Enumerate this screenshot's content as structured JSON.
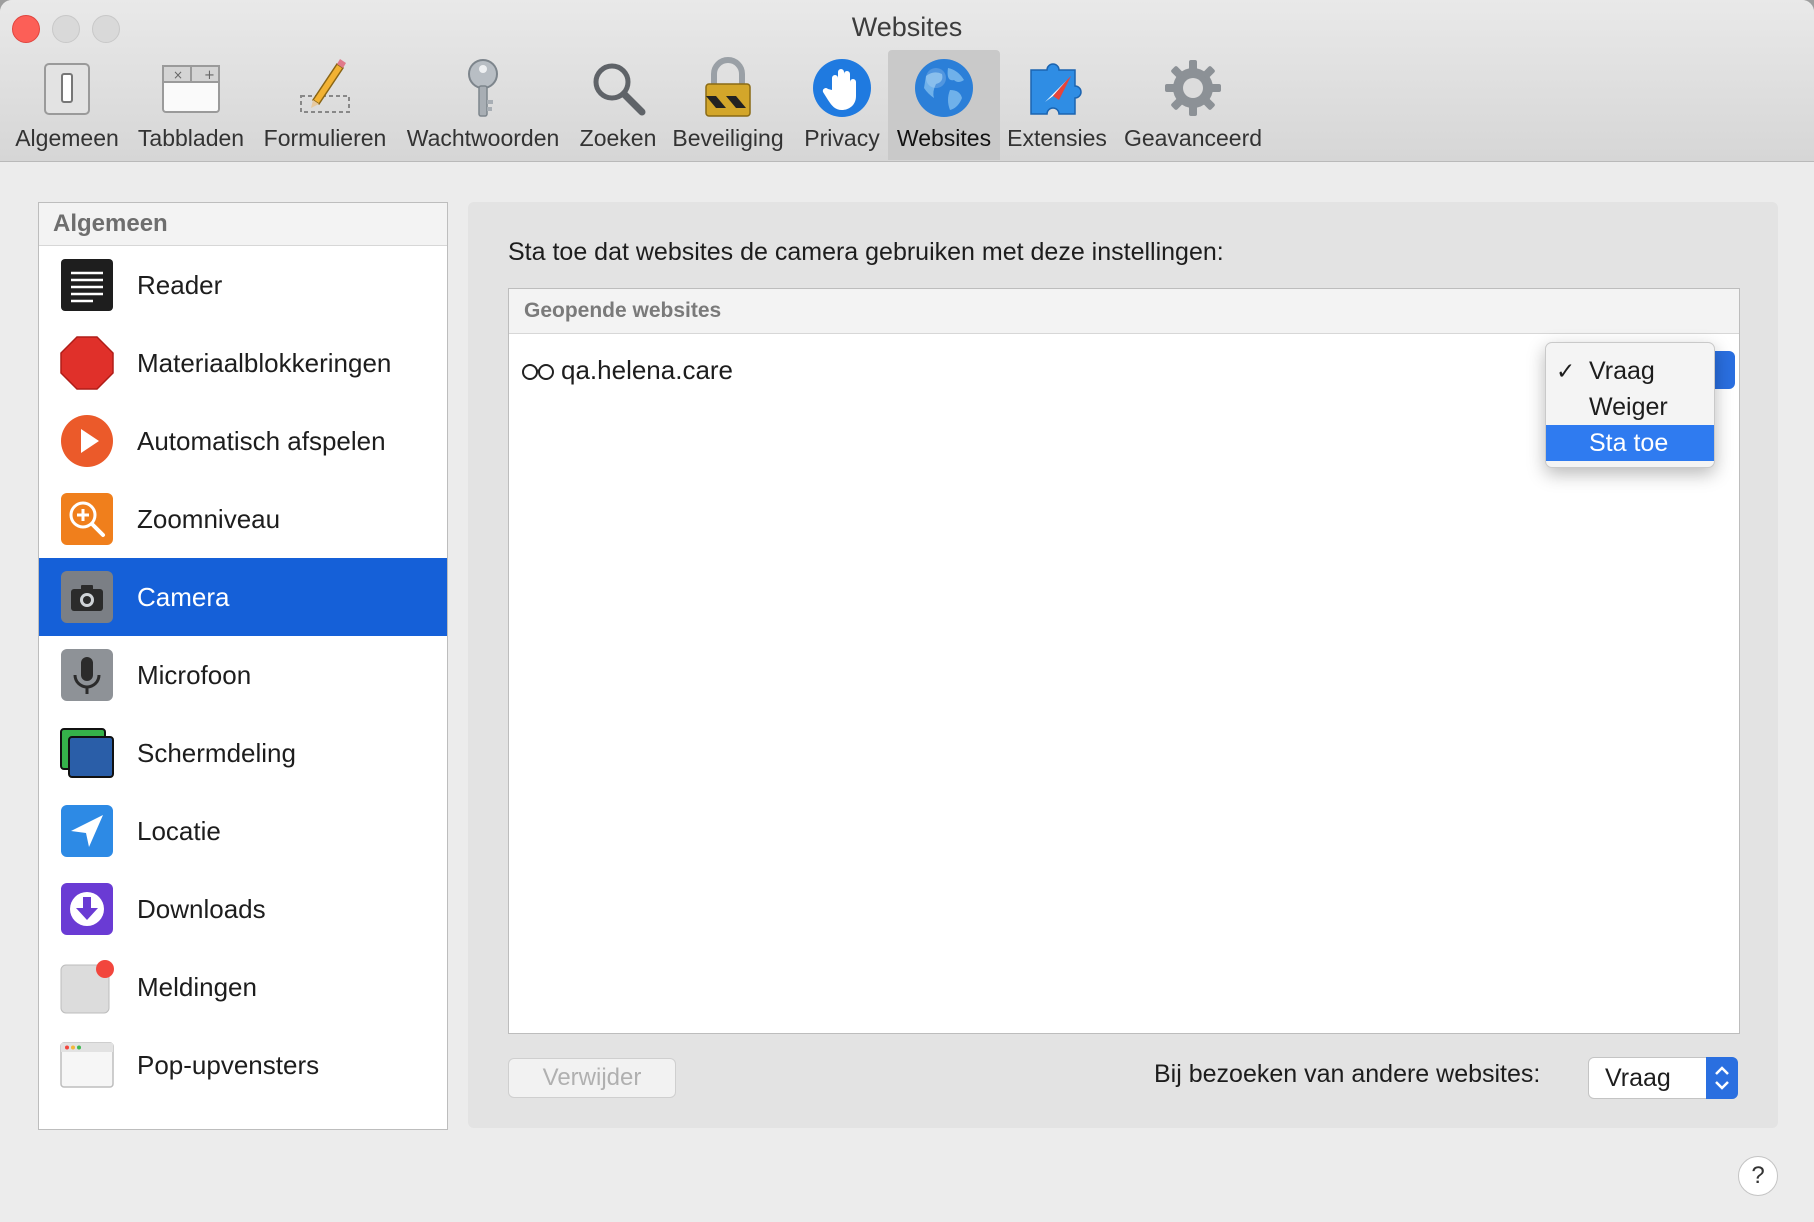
{
  "window": {
    "title": "Websites"
  },
  "toolbar": {
    "items": [
      {
        "label": "Algemeen",
        "icon": "switch-icon"
      },
      {
        "label": "Tabbladen",
        "icon": "tabs-icon"
      },
      {
        "label": "Formulieren",
        "icon": "pencil-icon"
      },
      {
        "label": "Wachtwoorden",
        "icon": "key-icon"
      },
      {
        "label": "Zoeken",
        "icon": "magnifier-icon"
      },
      {
        "label": "Beveiliging",
        "icon": "lock-icon"
      },
      {
        "label": "Privacy",
        "icon": "hand-icon"
      },
      {
        "label": "Websites",
        "icon": "globe-icon",
        "active": true
      },
      {
        "label": "Extensies",
        "icon": "puzzle-icon"
      },
      {
        "label": "Geavanceerd",
        "icon": "gear-icon"
      }
    ]
  },
  "sidebar": {
    "header": "Algemeen",
    "items": [
      {
        "label": "Reader",
        "icon": "reader-icon"
      },
      {
        "label": "Materiaalblokkeringen",
        "icon": "stop-icon"
      },
      {
        "label": "Automatisch afspelen",
        "icon": "play-icon"
      },
      {
        "label": "Zoomniveau",
        "icon": "zoom-icon"
      },
      {
        "label": "Camera",
        "icon": "camera-icon",
        "selected": true
      },
      {
        "label": "Microfoon",
        "icon": "microphone-icon"
      },
      {
        "label": "Schermdeling",
        "icon": "screen-share-icon"
      },
      {
        "label": "Locatie",
        "icon": "location-icon"
      },
      {
        "label": "Downloads",
        "icon": "download-icon"
      },
      {
        "label": "Meldingen",
        "icon": "notification-icon"
      },
      {
        "label": "Pop-upvensters",
        "icon": "popup-window-icon"
      }
    ]
  },
  "main": {
    "title": "Sta toe dat websites de camera gebruiken met deze instellingen:",
    "sites_header": "Geopende websites",
    "sites": [
      {
        "name": "qa.helena.care",
        "icon": "reader-glasses-icon"
      }
    ],
    "menu": {
      "options": [
        "Vraag",
        "Weiger",
        "Sta toe"
      ],
      "checked": "Vraag",
      "highlighted": "Sta toe"
    },
    "remove_label": "Verwijder",
    "other_label": "Bij bezoeken van andere websites:",
    "other_value": "Vraag",
    "help_label": "?"
  },
  "colors": {
    "accent": "#1560d8",
    "highlight": "#2f7bf0",
    "close": "#fc5f57"
  }
}
